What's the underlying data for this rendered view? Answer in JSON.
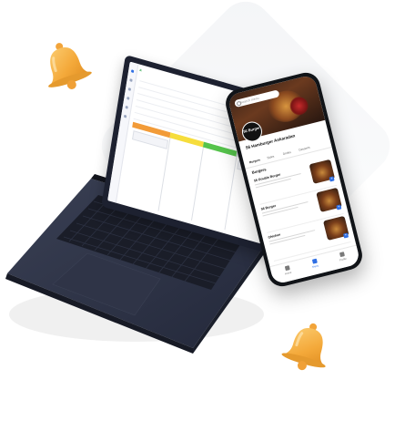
{
  "colors": {
    "bell": "#f7b24a",
    "laptop_body": "#2b3041",
    "accent_blue": "#2f6fe4",
    "status_orange": "#f29b38",
    "status_yellow": "#f6dd3c",
    "status_green": "#56c44c"
  },
  "laptop": {
    "app_logo": "a",
    "status_columns": [
      "",
      "",
      "",
      ""
    ]
  },
  "phone": {
    "search_placeholder": "Search menu",
    "store_badge": "56 Burger",
    "store_name": "56 Hamburger Ankaradan",
    "store_subtitle": "",
    "tabs": [
      "Burgers",
      "Sides",
      "Drinks",
      "Desserts"
    ],
    "section_title": "Burgers",
    "menu_items": [
      {
        "name": "56 Double Burger",
        "price": "",
        "old_price": ""
      },
      {
        "name": "56 Burger",
        "price": "",
        "old_price": ""
      },
      {
        "name": "Chicken",
        "price": "",
        "old_price": ""
      }
    ],
    "nav": [
      {
        "label": "Home",
        "icon": "home-icon"
      },
      {
        "label": "Menu",
        "icon": "menu-icon"
      },
      {
        "label": "Profile",
        "icon": "profile-icon"
      }
    ]
  },
  "icons": [
    "bell-icon",
    "search-icon",
    "home-icon",
    "menu-icon",
    "profile-icon"
  ]
}
